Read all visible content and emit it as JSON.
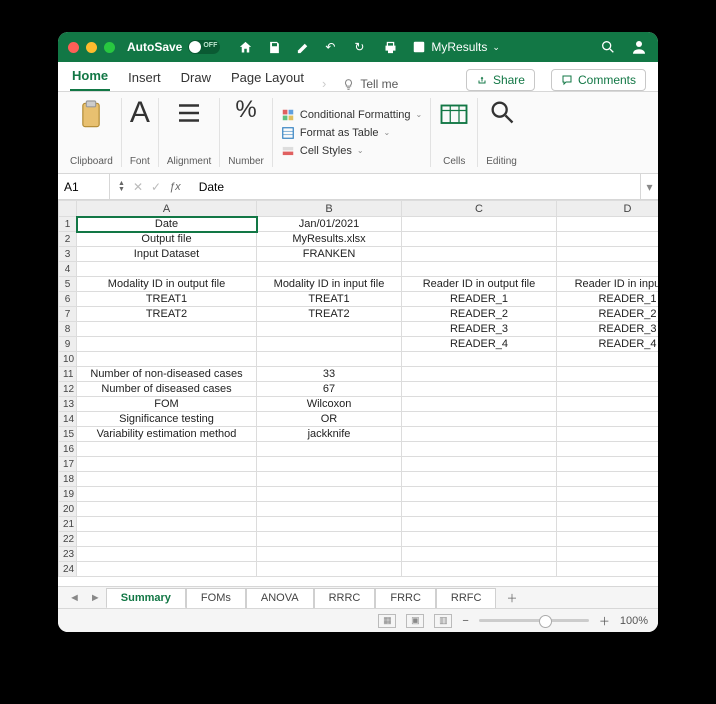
{
  "titlebar": {
    "autosave": "AutoSave",
    "docname": "MyResults"
  },
  "tabs": {
    "home": "Home",
    "insert": "Insert",
    "draw": "Draw",
    "page_layout": "Page Layout",
    "tell_me": "Tell me",
    "share": "Share",
    "comments": "Comments"
  },
  "ribbon": {
    "clipboard": "Clipboard",
    "font": "Font",
    "alignment": "Alignment",
    "number": "Number",
    "cond_fmt": "Conditional Formatting",
    "fmt_table": "Format as Table",
    "cell_styles": "Cell Styles",
    "cells": "Cells",
    "editing": "Editing"
  },
  "formula_bar": {
    "cell_ref": "A1",
    "content": "Date"
  },
  "columns": [
    "A",
    "B",
    "C",
    "D"
  ],
  "rows": [
    {
      "n": 1,
      "A": "Date",
      "B": "Jan/01/2021",
      "C": "",
      "D": ""
    },
    {
      "n": 2,
      "A": "Output file",
      "B": "MyResults.xlsx",
      "C": "",
      "D": ""
    },
    {
      "n": 3,
      "A": "Input Dataset",
      "B": "FRANKEN",
      "C": "",
      "D": ""
    },
    {
      "n": 4,
      "A": "",
      "B": "",
      "C": "",
      "D": ""
    },
    {
      "n": 5,
      "A": "Modality ID in output file",
      "B": "Modality ID in input file",
      "C": "Reader ID in output file",
      "D": "Reader ID in input file"
    },
    {
      "n": 6,
      "A": "TREAT1",
      "B": "TREAT1",
      "C": "READER_1",
      "D": "READER_1"
    },
    {
      "n": 7,
      "A": "TREAT2",
      "B": "TREAT2",
      "C": "READER_2",
      "D": "READER_2"
    },
    {
      "n": 8,
      "A": "",
      "B": "",
      "C": "READER_3",
      "D": "READER_3"
    },
    {
      "n": 9,
      "A": "",
      "B": "",
      "C": "READER_4",
      "D": "READER_4"
    },
    {
      "n": 10,
      "A": "",
      "B": "",
      "C": "",
      "D": ""
    },
    {
      "n": 11,
      "A": "Number of non-diseased cases",
      "B": "33",
      "C": "",
      "D": ""
    },
    {
      "n": 12,
      "A": "Number of diseased cases",
      "B": "67",
      "C": "",
      "D": ""
    },
    {
      "n": 13,
      "A": "FOM",
      "B": "Wilcoxon",
      "C": "",
      "D": ""
    },
    {
      "n": 14,
      "A": "Significance testing",
      "B": "OR",
      "C": "",
      "D": ""
    },
    {
      "n": 15,
      "A": "Variability estimation method",
      "B": "jackknife",
      "C": "",
      "D": ""
    },
    {
      "n": 16,
      "A": "",
      "B": "",
      "C": "",
      "D": ""
    },
    {
      "n": 17,
      "A": "",
      "B": "",
      "C": "",
      "D": ""
    },
    {
      "n": 18,
      "A": "",
      "B": "",
      "C": "",
      "D": ""
    },
    {
      "n": 19,
      "A": "",
      "B": "",
      "C": "",
      "D": ""
    },
    {
      "n": 20,
      "A": "",
      "B": "",
      "C": "",
      "D": ""
    },
    {
      "n": 21,
      "A": "",
      "B": "",
      "C": "",
      "D": ""
    },
    {
      "n": 22,
      "A": "",
      "B": "",
      "C": "",
      "D": ""
    },
    {
      "n": 23,
      "A": "",
      "B": "",
      "C": "",
      "D": ""
    },
    {
      "n": 24,
      "A": "",
      "B": "",
      "C": "",
      "D": ""
    }
  ],
  "sheets": [
    "Summary",
    "FOMs",
    "ANOVA",
    "RRRC",
    "FRRC",
    "RRFC"
  ],
  "status": {
    "zoom": "100%"
  }
}
